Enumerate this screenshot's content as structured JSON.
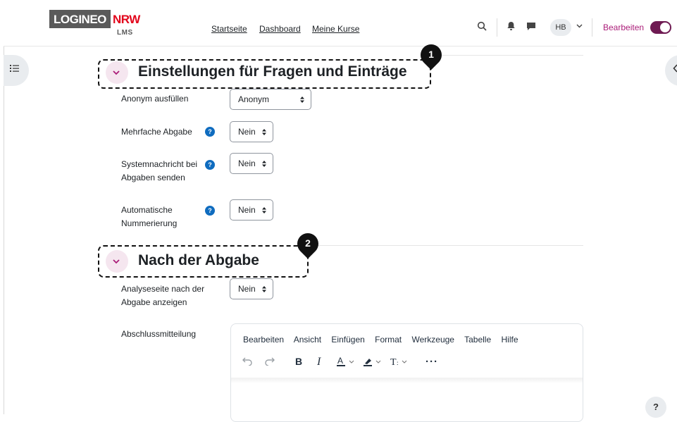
{
  "navbar": {
    "logo_left": "LOGINEO",
    "logo_right": "NRW",
    "logo_sub": "LMS",
    "links": [
      "Startseite",
      "Dashboard",
      "Meine Kurse"
    ],
    "avatar_initials": "HB",
    "edit_label": "Bearbeiten",
    "edit_mode_on": true
  },
  "sections": [
    {
      "title": "Einstellungen für Fragen und Einträge",
      "marker": "1",
      "fields": [
        {
          "label": "Anonym ausfüllen",
          "value": "Anonym",
          "help": false
        },
        {
          "label": "Mehrfache Abgabe",
          "value": "Nein",
          "help": true
        },
        {
          "label_lines": [
            "Systemnachricht bei",
            "Abgaben senden"
          ],
          "value": "Nein",
          "help": true
        },
        {
          "label_lines": [
            "Automatische",
            "Nummerierung"
          ],
          "value": "Nein",
          "help": true
        }
      ]
    },
    {
      "title": "Nach der Abgabe",
      "marker": "2",
      "fields": [
        {
          "label_lines": [
            "Analyseseite nach der",
            "Abgabe anzeigen"
          ],
          "value": "Nein",
          "help": false
        },
        {
          "label": "Abschlussmitteilung"
        }
      ]
    }
  ],
  "editor": {
    "menu": [
      "Bearbeiten",
      "Ansicht",
      "Einfügen",
      "Format",
      "Werkzeuge",
      "Tabelle",
      "Hilfe"
    ],
    "toolbar_icons": [
      "undo-icon",
      "redo-icon",
      "bold-icon",
      "italic-icon",
      "text-color-icon",
      "highlight-icon",
      "text-size-icon",
      "more-icon"
    ]
  },
  "help_button": "?",
  "colors": {
    "accent": "#ab1d79",
    "toggle": "#6e1a52",
    "help_icon": "#0f6cbf",
    "logo_red": "#e2051b"
  }
}
